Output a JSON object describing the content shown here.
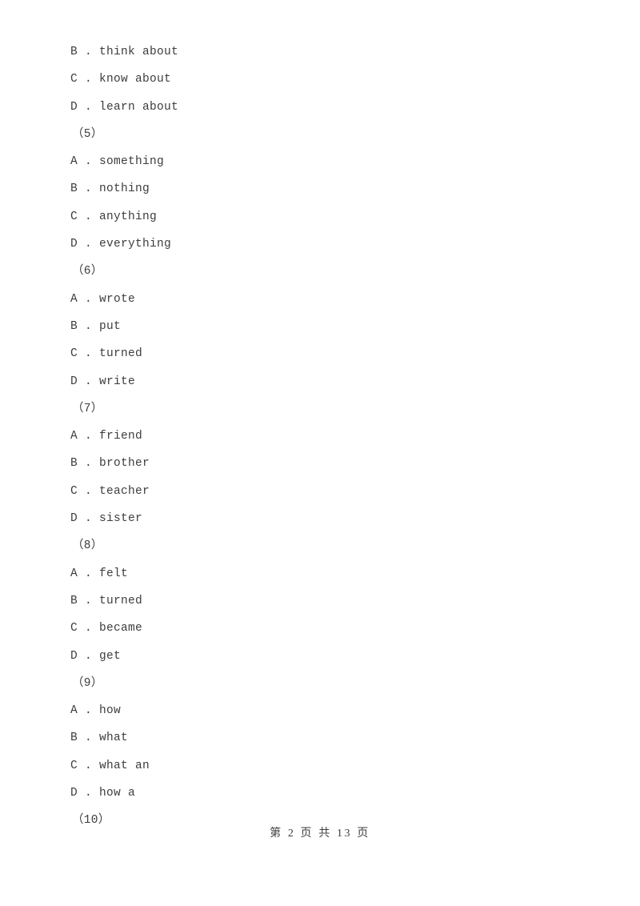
{
  "document": {
    "page_background": "#ffffff",
    "text_color": "#3d3d3d"
  },
  "body_lines": [
    {
      "kind": "option",
      "letter": "B",
      "sep": " . ",
      "text": "think about"
    },
    {
      "kind": "option",
      "letter": "C",
      "sep": " . ",
      "text": "know about"
    },
    {
      "kind": "option",
      "letter": "D",
      "sep": " . ",
      "text": "learn about"
    },
    {
      "kind": "qnum",
      "text": "（5）"
    },
    {
      "kind": "option",
      "letter": "A",
      "sep": " . ",
      "text": "something"
    },
    {
      "kind": "option",
      "letter": "B",
      "sep": " . ",
      "text": "nothing"
    },
    {
      "kind": "option",
      "letter": "C",
      "sep": " . ",
      "text": "anything"
    },
    {
      "kind": "option",
      "letter": "D",
      "sep": " . ",
      "text": "everything"
    },
    {
      "kind": "qnum",
      "text": "（6）"
    },
    {
      "kind": "option",
      "letter": "A",
      "sep": " . ",
      "text": "wrote"
    },
    {
      "kind": "option",
      "letter": "B",
      "sep": " . ",
      "text": "put"
    },
    {
      "kind": "option",
      "letter": "C",
      "sep": " . ",
      "text": "turned"
    },
    {
      "kind": "option",
      "letter": "D",
      "sep": " . ",
      "text": "write"
    },
    {
      "kind": "qnum",
      "text": "（7）"
    },
    {
      "kind": "option",
      "letter": "A",
      "sep": " . ",
      "text": "friend"
    },
    {
      "kind": "option",
      "letter": "B",
      "sep": " . ",
      "text": "brother"
    },
    {
      "kind": "option",
      "letter": "C",
      "sep": " . ",
      "text": "teacher"
    },
    {
      "kind": "option",
      "letter": "D",
      "sep": " . ",
      "text": "sister"
    },
    {
      "kind": "qnum",
      "text": "（8）"
    },
    {
      "kind": "option",
      "letter": "A",
      "sep": " . ",
      "text": "felt"
    },
    {
      "kind": "option",
      "letter": "B",
      "sep": " . ",
      "text": "turned"
    },
    {
      "kind": "option",
      "letter": "C",
      "sep": " . ",
      "text": "became"
    },
    {
      "kind": "option",
      "letter": "D",
      "sep": " . ",
      "text": "get"
    },
    {
      "kind": "qnum",
      "text": "（9）"
    },
    {
      "kind": "option",
      "letter": "A",
      "sep": " . ",
      "text": "how"
    },
    {
      "kind": "option",
      "letter": "B",
      "sep": " . ",
      "text": "what"
    },
    {
      "kind": "option",
      "letter": "C",
      "sep": " . ",
      "text": "what an"
    },
    {
      "kind": "option",
      "letter": "D",
      "sep": " . ",
      "text": "how a"
    },
    {
      "kind": "qnum",
      "text": "（10）"
    }
  ],
  "footer": {
    "text": "第 2 页 共 13 页",
    "page_number": "2",
    "total_pages": "13"
  }
}
